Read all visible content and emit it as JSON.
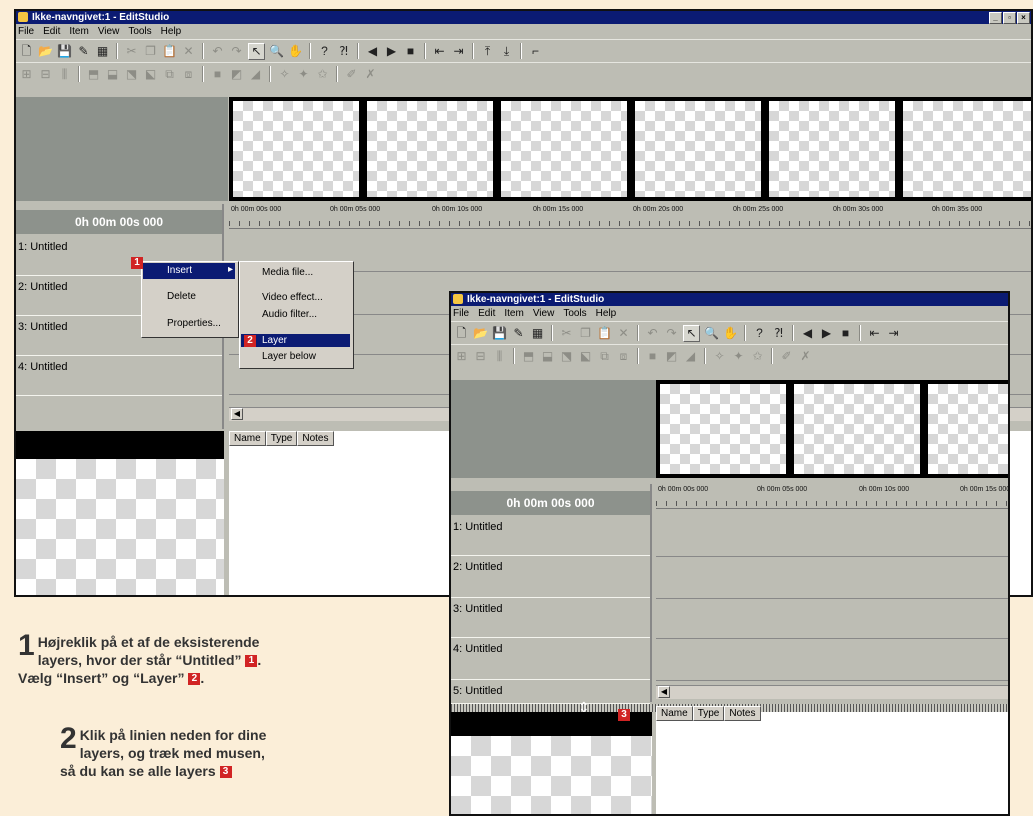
{
  "window": {
    "title": "Ikke-navngivet:1 - EditStudio",
    "menu": [
      "File",
      "Edit",
      "Item",
      "View",
      "Tools",
      "Help"
    ],
    "controls": [
      "_",
      "▫",
      "×"
    ]
  },
  "timeline": {
    "time_display": "0h 00m 00s 000",
    "ruler_ticks": [
      "0h 00m 00s 000",
      "0h 00m 05s 000",
      "0h 00m 10s 000",
      "0h 00m 15s 000",
      "0h 00m 20s 000",
      "0h 00m 25s 000",
      "0h 00m 30s 000",
      "0h 00m 35s 000"
    ],
    "layers_main": [
      "1: Untitled",
      "2: Untitled",
      "3: Untitled",
      "4: Untitled"
    ],
    "layers_inset": [
      "1: Untitled",
      "2: Untitled",
      "3: Untitled",
      "4: Untitled",
      "5: Untitled"
    ]
  },
  "list_columns": [
    "Name",
    "Type",
    "Notes"
  ],
  "context_menu": {
    "items": [
      "Insert",
      "Delete",
      "Properties..."
    ],
    "submenu": [
      "Media file...",
      "Video effect...",
      "Audio filter...",
      "Layer",
      "Layer below"
    ],
    "highlighted": "Layer"
  },
  "badges": [
    "1",
    "2",
    "3"
  ],
  "instructions": {
    "step1_num": "1",
    "step1_line1": "Højreklik på et af de eksisterende",
    "step1_line2": "layers, hvor der står “Untitled”",
    "step1_line3a": "Vælg “Insert” og “Layer”",
    "step2_num": "2",
    "step2_line1": "Klik på linien neden for dine",
    "step2_line2": "layers, og træk med musen,",
    "step2_line3": "så du kan se alle layers"
  },
  "colors": {
    "titlebar": "#0b1b73",
    "badge": "#d12424",
    "background": "#fbeed8",
    "window": "#bdbdb4"
  }
}
